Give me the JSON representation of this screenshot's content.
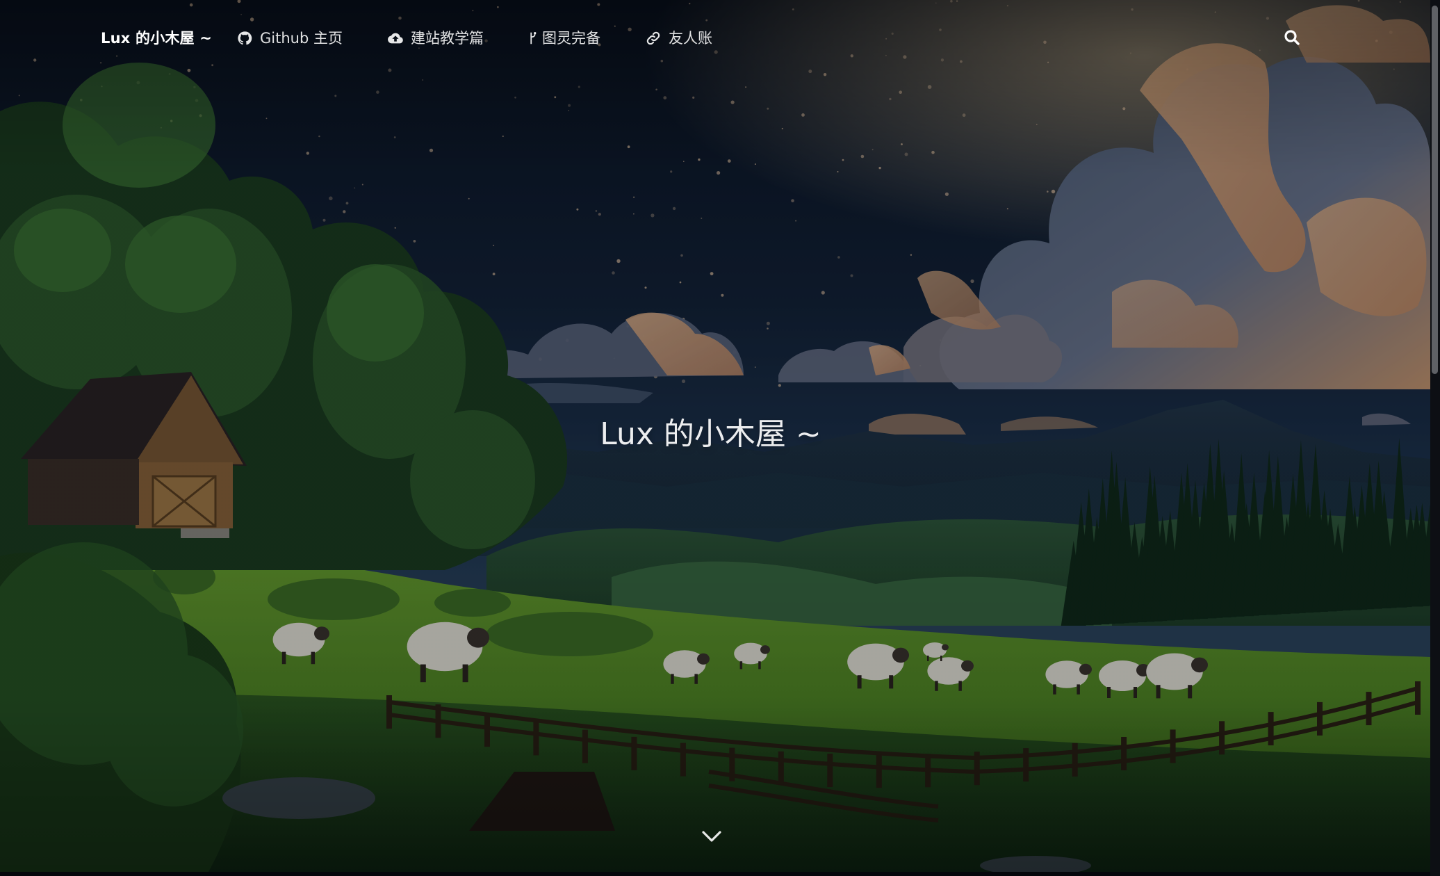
{
  "site": {
    "brand": "Lux 的小木屋 ~",
    "hero_title": "Lux 的小木屋 ~"
  },
  "nav": {
    "items": [
      {
        "label": "Github 主页",
        "icon": "github-icon"
      },
      {
        "label": "建站教学篇",
        "icon": "cloud-upload-icon"
      },
      {
        "label": "图灵完备",
        "icon": "branch-icon"
      },
      {
        "label": "友人账",
        "icon": "link-icon"
      }
    ],
    "search_icon": "search-icon"
  },
  "colors": {
    "nav_text": "#ffffff",
    "sky_top": "#0c1424",
    "sky_mid": "#1a2e48",
    "meadow": "#5f9a2c",
    "forest": "#0e2418"
  },
  "icons": {
    "scroll_down": "chevron-down-icon"
  }
}
